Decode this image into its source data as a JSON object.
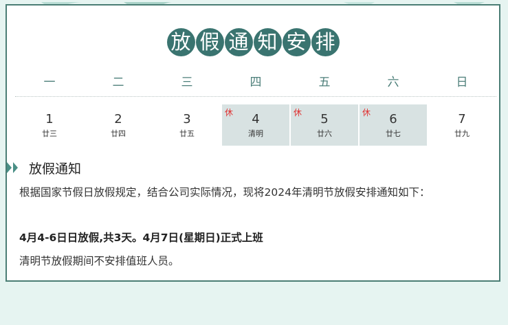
{
  "title_chars": [
    "放",
    "假",
    "通",
    "知",
    "安",
    "排"
  ],
  "weekdays": [
    "一",
    "二",
    "三",
    "四",
    "五",
    "六",
    "日"
  ],
  "days": [
    {
      "num": "1",
      "lunar": "廿三",
      "rest": ""
    },
    {
      "num": "2",
      "lunar": "廿四",
      "rest": ""
    },
    {
      "num": "3",
      "lunar": "廿五",
      "rest": ""
    },
    {
      "num": "4",
      "lunar": "清明",
      "rest": "休"
    },
    {
      "num": "5",
      "lunar": "廿六",
      "rest": "休"
    },
    {
      "num": "6",
      "lunar": "廿七",
      "rest": "休"
    },
    {
      "num": "7",
      "lunar": "廿九",
      "rest": ""
    }
  ],
  "section": {
    "title": "放假通知"
  },
  "body": {
    "p1": "根据国家节假日放假规定，结合公司实际情况，现将2024年清明节放假安排通知如下：",
    "p2": "4月4-6日日放假,共3天。4月7日(星期日)正式上班",
    "p3": "清明节放假期间不安排值班人员。"
  },
  "colors": {
    "accent": "#3a7470",
    "holiday_bg": "#d8e2e2",
    "rest_red": "#e03030",
    "border": "#4a7d74"
  }
}
